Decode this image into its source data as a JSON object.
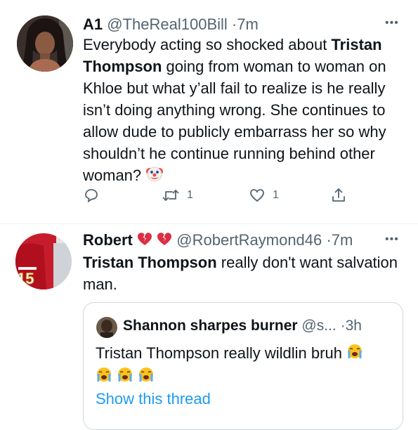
{
  "tweets": [
    {
      "display_name": "A1",
      "handle": "@TheReal100Bill",
      "dot": "·",
      "time": "7m",
      "more": "•••",
      "text_parts": [
        {
          "t": "Everybody acting so shocked about ",
          "b": false
        },
        {
          "t": "Tristan Thompson",
          "b": true
        },
        {
          "t": " going from woman to woman on Khloe but what y’all fail to realize is he really isn’t doing anything wrong. She continues to allow dude to publicly embarrass her so why shouldn’t he continue running behind other woman? ",
          "b": false
        }
      ],
      "emoji": "clown-face",
      "actions": {
        "reply_count": "",
        "retweet_count": "1",
        "like_count": "1"
      }
    },
    {
      "display_name": "Robert",
      "name_emojis": [
        "broken-heart",
        "broken-heart"
      ],
      "handle": "@RobertRaymond46",
      "dot": "·",
      "time": "7m",
      "more": "•••",
      "text_parts": [
        {
          "t": "Tristan Thompson",
          "b": true
        },
        {
          "t": " really don't want salvation man.",
          "b": false
        }
      ],
      "avatar_jersey_number": "15",
      "quote": {
        "display_name": "Shannon sharpes burner",
        "handle": "@s...",
        "dot": "·",
        "time": "3h",
        "text": "Tristan Thompson really wildlin bruh",
        "emojis": [
          "loudly-crying-face",
          "loudly-crying-face",
          "loudly-crying-face",
          "loudly-crying-face"
        ],
        "show_thread": "Show this thread"
      }
    }
  ],
  "colors": {
    "text": "#0f1419",
    "muted": "#536471",
    "link": "#1d9bf0",
    "divider": "#eff3f4",
    "border": "#cfd9de"
  }
}
